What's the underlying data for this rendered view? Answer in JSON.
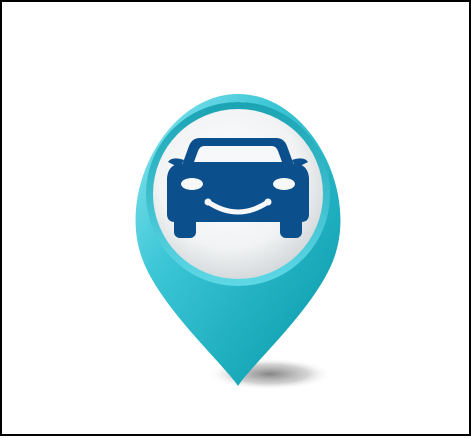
{
  "image": {
    "icon": "car-location-pin-icon",
    "colors": {
      "frame_border": "#000000",
      "background": "#ffffff",
      "pin_teal_light": "#7ee3ef",
      "pin_teal": "#2bbfcf",
      "pin_teal_dark": "#129aaa",
      "inner_disc": "#f4f6f7",
      "car": "#0b4f8c",
      "shadow": "#8a8a8a"
    }
  }
}
